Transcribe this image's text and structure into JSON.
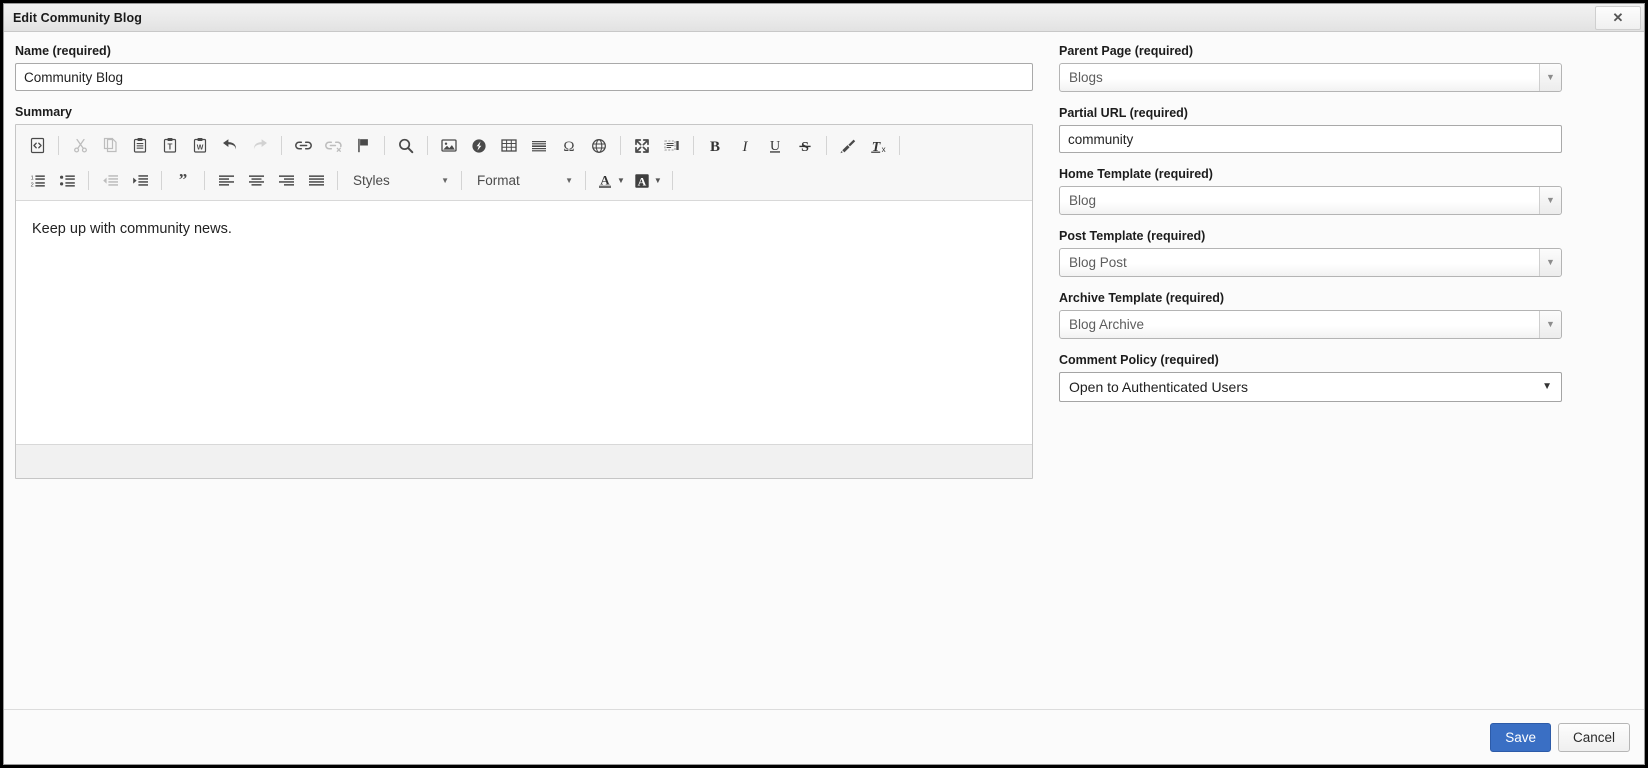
{
  "window": {
    "title": "Edit Community Blog",
    "close_label": "✕"
  },
  "left": {
    "name_label": "Name (required)",
    "name_value": "Community Blog",
    "name_placeholder": "",
    "summary_label": "Summary",
    "editor": {
      "content": "Keep up with community news.",
      "toolbar_row1": [
        {
          "name": "source-icon",
          "title": "Source",
          "disabled": false
        },
        {
          "name": "cut-icon",
          "title": "Cut",
          "disabled": true
        },
        {
          "name": "copy-icon",
          "title": "Copy",
          "disabled": true
        },
        {
          "name": "paste-icon",
          "title": "Paste",
          "disabled": false
        },
        {
          "name": "paste-as-text-icon",
          "title": "Paste as plain text",
          "disabled": false
        },
        {
          "name": "paste-from-word-icon",
          "title": "Paste from Word",
          "disabled": false
        },
        {
          "name": "undo-icon",
          "title": "Undo",
          "disabled": false
        },
        {
          "name": "redo-icon",
          "title": "Redo",
          "disabled": true
        },
        {
          "name": "link-icon",
          "title": "Link",
          "disabled": false
        },
        {
          "name": "unlink-icon",
          "title": "Unlink",
          "disabled": true
        },
        {
          "name": "anchor-flag-icon",
          "title": "Anchor",
          "disabled": false
        },
        {
          "name": "find-icon",
          "title": "Find",
          "disabled": false
        },
        {
          "name": "image-icon",
          "title": "Image",
          "disabled": false
        },
        {
          "name": "flash-icon",
          "title": "Flash",
          "disabled": false
        },
        {
          "name": "table-icon",
          "title": "Table",
          "disabled": false
        },
        {
          "name": "horizontal-rule-icon",
          "title": "Horizontal Line",
          "disabled": false
        },
        {
          "name": "special-character-icon",
          "title": "Insert Special Character",
          "disabled": false
        },
        {
          "name": "iframe-globe-icon",
          "title": "IFrame",
          "disabled": false
        },
        {
          "name": "maximize-icon",
          "title": "Maximize",
          "disabled": false
        },
        {
          "name": "show-blocks-icon",
          "title": "Show Blocks",
          "disabled": false
        },
        {
          "name": "bold-icon",
          "title": "Bold",
          "disabled": false
        },
        {
          "name": "italic-icon",
          "title": "Italic",
          "disabled": false
        },
        {
          "name": "underline-icon",
          "title": "Underline",
          "disabled": false
        },
        {
          "name": "strikethrough-icon",
          "title": "Strike Through",
          "disabled": false
        },
        {
          "name": "copy-formatting-icon",
          "title": "Copy Formatting",
          "disabled": false
        },
        {
          "name": "remove-format-icon",
          "title": "Remove Format",
          "disabled": false
        }
      ],
      "toolbar_row2": [
        {
          "name": "numbered-list-icon",
          "title": "Insert/Remove Numbered List",
          "disabled": false
        },
        {
          "name": "bulleted-list-icon",
          "title": "Insert/Remove Bulleted List",
          "disabled": false
        },
        {
          "name": "outdent-icon",
          "title": "Decrease Indent",
          "disabled": true
        },
        {
          "name": "indent-icon",
          "title": "Increase Indent",
          "disabled": false
        },
        {
          "name": "blockquote-icon",
          "title": "Block Quote",
          "disabled": false
        },
        {
          "name": "align-left-icon",
          "title": "Align Left",
          "disabled": false
        },
        {
          "name": "align-center-icon",
          "title": "Center",
          "disabled": false
        },
        {
          "name": "align-right-icon",
          "title": "Align Right",
          "disabled": false
        },
        {
          "name": "align-justify-icon",
          "title": "Justify",
          "disabled": false
        }
      ],
      "styles_combo": "Styles",
      "format_combo": "Format",
      "text_color_label": "A",
      "bg_color_label": "A"
    }
  },
  "right": {
    "fields": [
      {
        "label": "Parent Page (required)",
        "value": "Blogs",
        "control": "select-styled",
        "name": "parent-page-select"
      },
      {
        "label": "Partial URL (required)",
        "value": "community",
        "control": "text",
        "name": "partial-url-input"
      },
      {
        "label": "Home Template (required)",
        "value": "Blog",
        "control": "select-styled",
        "name": "home-template-select"
      },
      {
        "label": "Post Template (required)",
        "value": "Blog Post",
        "control": "select-styled",
        "name": "post-template-select"
      },
      {
        "label": "Archive Template (required)",
        "value": "Blog Archive",
        "control": "select-styled",
        "name": "archive-template-select"
      },
      {
        "label": "Comment Policy (required)",
        "value": "Open to Authenticated Users",
        "control": "select-native",
        "name": "comment-policy-select"
      }
    ]
  },
  "footer": {
    "save_label": "Save",
    "cancel_label": "Cancel"
  },
  "colors": {
    "primary": "#3a6fc4",
    "titlebar": "#eaeaea",
    "page_bg": "#fbfbfb"
  }
}
